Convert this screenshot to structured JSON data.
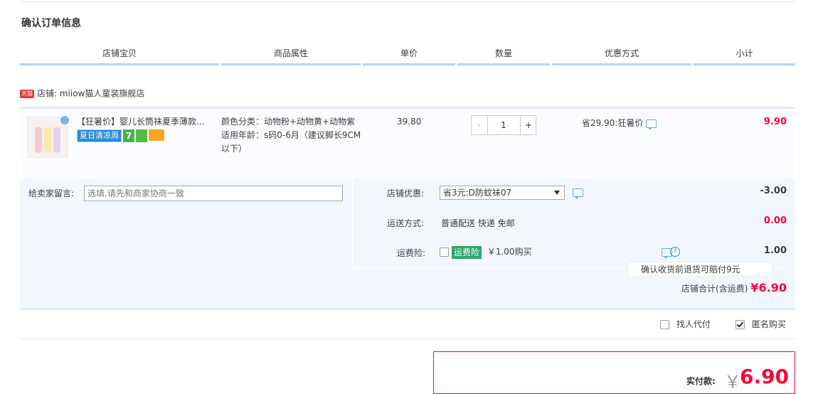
{
  "section_title": "确认订单信息",
  "table_headers": [
    "店铺宝贝",
    "商品属性",
    "单价",
    "数量",
    "优惠方式",
    "小计"
  ],
  "shop": {
    "badge": "天猫",
    "label": "店铺: miiow猫人童装旗舰店"
  },
  "item": {
    "title": "【狂暑价】婴儿长筒袜夏季薄款...",
    "badge_summer": "夏日清凉周",
    "badge_7": "7",
    "attr_color": "颜色分类：动物粉+动物黄+动物紫",
    "attr_age": "适用年龄：s码0-6月（建议脚长9CM以下）",
    "price": "39.80",
    "qty_minus": "-",
    "qty_value": "1",
    "qty_plus": "+",
    "discount": "省29.90:狂暑价",
    "subtotal": "9.90"
  },
  "message": {
    "label": "给卖家留言:",
    "placeholder": "选填,请先和商家协商一致"
  },
  "shop_discount": {
    "label": "店铺优惠:",
    "selected": "省3元:D防蚊袜07",
    "value": "-3.00"
  },
  "shipping": {
    "label": "运送方式:",
    "method": "普通配送 快递 免邮",
    "value": "0.00"
  },
  "insurance": {
    "label": "运费险:",
    "tag": "运费险",
    "price": "￥1.00购买",
    "value": "1.00",
    "tooltip": "确认收货前退货可赔付9元"
  },
  "shop_total": {
    "label": "店铺合计(含运费)",
    "amount": "¥6.90"
  },
  "extras": {
    "proxy_pay": "找人代付",
    "anonymous": "匿名购买"
  },
  "payment": {
    "label": "实付款:",
    "currency": "￥",
    "amount": "6.90"
  },
  "colors": {
    "accent_red": "#ff0036",
    "header_blue": "#b2d1ff",
    "row_bg": "#f2f7ff"
  }
}
